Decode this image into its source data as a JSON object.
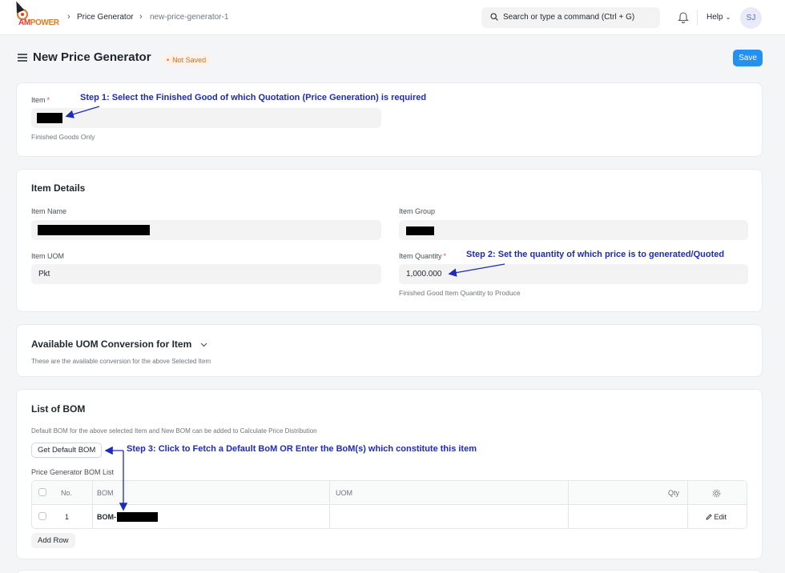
{
  "navbar": {
    "logo_text_a": "AM",
    "logo_text_b": "POWER",
    "breadcrumbs": [
      "Price Generator",
      "new-price-generator-1"
    ],
    "search_placeholder": "Search or type a command (Ctrl + G)",
    "help_label": "Help",
    "avatar_initials": "SJ"
  },
  "page": {
    "title": "New Price Generator",
    "status": "Not Saved",
    "save_label": "Save"
  },
  "item_section": {
    "item_label": "Item",
    "required_mark": "*",
    "item_description": "Finished Goods Only",
    "note": "Step 1: Select the Finished Good of which Quotation (Price Generation) is required"
  },
  "item_details": {
    "title": "Item Details",
    "item_name_label": "Item Name",
    "item_group_label": "Item Group",
    "item_uom_label": "Item UOM",
    "item_uom_value": "Pkt",
    "item_quantity_label": "Item Quantity",
    "item_quantity_value": "1,000.000",
    "item_quantity_description": "Finished Good Item Quantity to Produce",
    "note": "Step 2: Set the quantity of which price is to generated/Quoted"
  },
  "uom_conversion": {
    "title": "Available UOM Conversion for Item",
    "description": "These are the available conversion for the above Selected Item"
  },
  "bom_section": {
    "title": "List of BOM",
    "description": "Default BOM for the above selected Item and New BOM can be added to Calculate Price Distribution",
    "get_default_label": "Get Default BOM",
    "note": "Step 3: Click to Fetch a Default BoM OR Enter the BoM(s) which constitute this item",
    "table_label": "Price Generator BOM List",
    "columns": [
      "No.",
      "BOM",
      "UOM",
      "Qty"
    ],
    "rows": [
      {
        "no": "1",
        "bom_prefix": "BOM-",
        "uom": "",
        "qty": "",
        "edit_label": "Edit"
      }
    ],
    "add_row_label": "Add Row"
  },
  "colors": {
    "primary": "#2490ef",
    "annotation": "#1d2bb8",
    "not_saved": "#e86c13",
    "required": "#e24c4c"
  },
  "icons": [
    "search-icon",
    "bell-icon",
    "menu-icon",
    "chevron-down-icon",
    "settings-icon",
    "pencil-icon"
  ]
}
